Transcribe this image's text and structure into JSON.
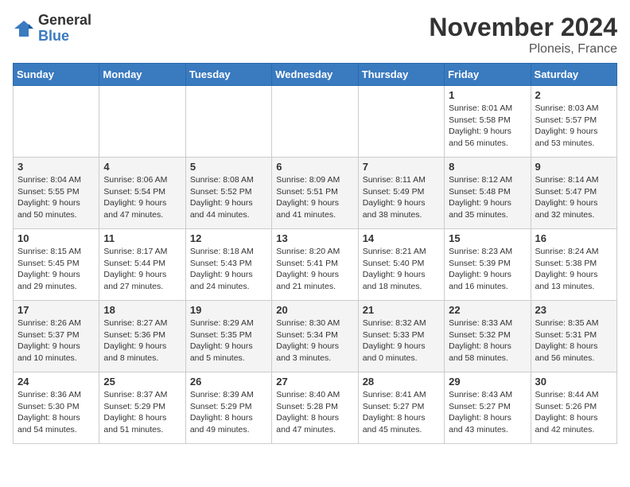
{
  "logo": {
    "general": "General",
    "blue": "Blue"
  },
  "title": "November 2024",
  "location": "Ploneis, France",
  "days_header": [
    "Sunday",
    "Monday",
    "Tuesday",
    "Wednesday",
    "Thursday",
    "Friday",
    "Saturday"
  ],
  "weeks": [
    [
      {
        "day": "",
        "info": ""
      },
      {
        "day": "",
        "info": ""
      },
      {
        "day": "",
        "info": ""
      },
      {
        "day": "",
        "info": ""
      },
      {
        "day": "",
        "info": ""
      },
      {
        "day": "1",
        "info": "Sunrise: 8:01 AM\nSunset: 5:58 PM\nDaylight: 9 hours and 56 minutes."
      },
      {
        "day": "2",
        "info": "Sunrise: 8:03 AM\nSunset: 5:57 PM\nDaylight: 9 hours and 53 minutes."
      }
    ],
    [
      {
        "day": "3",
        "info": "Sunrise: 8:04 AM\nSunset: 5:55 PM\nDaylight: 9 hours and 50 minutes."
      },
      {
        "day": "4",
        "info": "Sunrise: 8:06 AM\nSunset: 5:54 PM\nDaylight: 9 hours and 47 minutes."
      },
      {
        "day": "5",
        "info": "Sunrise: 8:08 AM\nSunset: 5:52 PM\nDaylight: 9 hours and 44 minutes."
      },
      {
        "day": "6",
        "info": "Sunrise: 8:09 AM\nSunset: 5:51 PM\nDaylight: 9 hours and 41 minutes."
      },
      {
        "day": "7",
        "info": "Sunrise: 8:11 AM\nSunset: 5:49 PM\nDaylight: 9 hours and 38 minutes."
      },
      {
        "day": "8",
        "info": "Sunrise: 8:12 AM\nSunset: 5:48 PM\nDaylight: 9 hours and 35 minutes."
      },
      {
        "day": "9",
        "info": "Sunrise: 8:14 AM\nSunset: 5:47 PM\nDaylight: 9 hours and 32 minutes."
      }
    ],
    [
      {
        "day": "10",
        "info": "Sunrise: 8:15 AM\nSunset: 5:45 PM\nDaylight: 9 hours and 29 minutes."
      },
      {
        "day": "11",
        "info": "Sunrise: 8:17 AM\nSunset: 5:44 PM\nDaylight: 9 hours and 27 minutes."
      },
      {
        "day": "12",
        "info": "Sunrise: 8:18 AM\nSunset: 5:43 PM\nDaylight: 9 hours and 24 minutes."
      },
      {
        "day": "13",
        "info": "Sunrise: 8:20 AM\nSunset: 5:41 PM\nDaylight: 9 hours and 21 minutes."
      },
      {
        "day": "14",
        "info": "Sunrise: 8:21 AM\nSunset: 5:40 PM\nDaylight: 9 hours and 18 minutes."
      },
      {
        "day": "15",
        "info": "Sunrise: 8:23 AM\nSunset: 5:39 PM\nDaylight: 9 hours and 16 minutes."
      },
      {
        "day": "16",
        "info": "Sunrise: 8:24 AM\nSunset: 5:38 PM\nDaylight: 9 hours and 13 minutes."
      }
    ],
    [
      {
        "day": "17",
        "info": "Sunrise: 8:26 AM\nSunset: 5:37 PM\nDaylight: 9 hours and 10 minutes."
      },
      {
        "day": "18",
        "info": "Sunrise: 8:27 AM\nSunset: 5:36 PM\nDaylight: 9 hours and 8 minutes."
      },
      {
        "day": "19",
        "info": "Sunrise: 8:29 AM\nSunset: 5:35 PM\nDaylight: 9 hours and 5 minutes."
      },
      {
        "day": "20",
        "info": "Sunrise: 8:30 AM\nSunset: 5:34 PM\nDaylight: 9 hours and 3 minutes."
      },
      {
        "day": "21",
        "info": "Sunrise: 8:32 AM\nSunset: 5:33 PM\nDaylight: 9 hours and 0 minutes."
      },
      {
        "day": "22",
        "info": "Sunrise: 8:33 AM\nSunset: 5:32 PM\nDaylight: 8 hours and 58 minutes."
      },
      {
        "day": "23",
        "info": "Sunrise: 8:35 AM\nSunset: 5:31 PM\nDaylight: 8 hours and 56 minutes."
      }
    ],
    [
      {
        "day": "24",
        "info": "Sunrise: 8:36 AM\nSunset: 5:30 PM\nDaylight: 8 hours and 54 minutes."
      },
      {
        "day": "25",
        "info": "Sunrise: 8:37 AM\nSunset: 5:29 PM\nDaylight: 8 hours and 51 minutes."
      },
      {
        "day": "26",
        "info": "Sunrise: 8:39 AM\nSunset: 5:29 PM\nDaylight: 8 hours and 49 minutes."
      },
      {
        "day": "27",
        "info": "Sunrise: 8:40 AM\nSunset: 5:28 PM\nDaylight: 8 hours and 47 minutes."
      },
      {
        "day": "28",
        "info": "Sunrise: 8:41 AM\nSunset: 5:27 PM\nDaylight: 8 hours and 45 minutes."
      },
      {
        "day": "29",
        "info": "Sunrise: 8:43 AM\nSunset: 5:27 PM\nDaylight: 8 hours and 43 minutes."
      },
      {
        "day": "30",
        "info": "Sunrise: 8:44 AM\nSunset: 5:26 PM\nDaylight: 8 hours and 42 minutes."
      }
    ]
  ]
}
